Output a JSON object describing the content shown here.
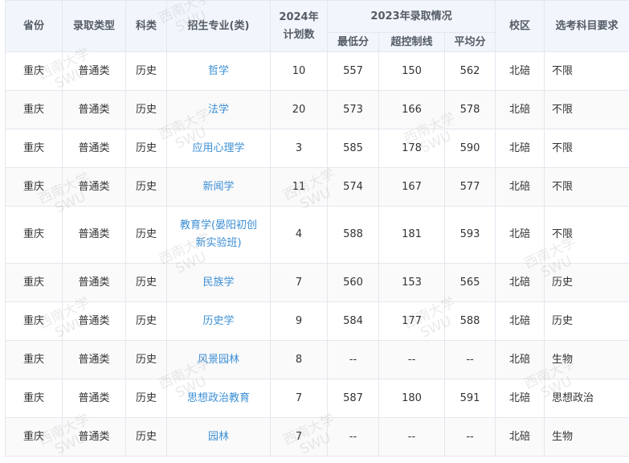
{
  "header": {
    "province": "省份",
    "admission_type": "录取类型",
    "subject_category": "科类",
    "major": "招生专业(类)",
    "plan_year": "2024年",
    "plan_label": "计划数",
    "group_2023": "2023年录取情况",
    "min_score": "最低分",
    "control_line": "超控制线",
    "avg_score": "平均分",
    "campus": "校区",
    "subject_requirement": "选考科目要求"
  },
  "rows": [
    {
      "province": "重庆",
      "type": "普通类",
      "category": "历史",
      "major": "哲学",
      "plan": "10",
      "min": "557",
      "over": "150",
      "avg": "562",
      "campus": "北碚",
      "req": "不限"
    },
    {
      "province": "重庆",
      "type": "普通类",
      "category": "历史",
      "major": "法学",
      "plan": "20",
      "min": "573",
      "over": "166",
      "avg": "578",
      "campus": "北碚",
      "req": "不限"
    },
    {
      "province": "重庆",
      "type": "普通类",
      "category": "历史",
      "major": "应用心理学",
      "plan": "3",
      "min": "585",
      "over": "178",
      "avg": "590",
      "campus": "北碚",
      "req": "不限"
    },
    {
      "province": "重庆",
      "type": "普通类",
      "category": "历史",
      "major": "新闻学",
      "plan": "11",
      "min": "574",
      "over": "167",
      "avg": "577",
      "campus": "北碚",
      "req": "不限"
    },
    {
      "province": "重庆",
      "type": "普通类",
      "category": "历史",
      "major_line1": "教育学(晏阳初创",
      "major_line2": "新实验班)",
      "plan": "4",
      "min": "588",
      "over": "181",
      "avg": "593",
      "campus": "北碚",
      "req": "不限"
    },
    {
      "province": "重庆",
      "type": "普通类",
      "category": "历史",
      "major": "民族学",
      "plan": "7",
      "min": "560",
      "over": "153",
      "avg": "565",
      "campus": "北碚",
      "req": "历史"
    },
    {
      "province": "重庆",
      "type": "普通类",
      "category": "历史",
      "major": "历史学",
      "plan": "9",
      "min": "584",
      "over": "177",
      "avg": "588",
      "campus": "北碚",
      "req": "历史"
    },
    {
      "province": "重庆",
      "type": "普通类",
      "category": "历史",
      "major": "风景园林",
      "plan": "8",
      "min": "--",
      "over": "--",
      "avg": "--",
      "campus": "北碚",
      "req": "生物"
    },
    {
      "province": "重庆",
      "type": "普通类",
      "category": "历史",
      "major": "思想政治教育",
      "plan": "7",
      "min": "587",
      "over": "180",
      "avg": "591",
      "campus": "北碚",
      "req": "思想政治"
    },
    {
      "province": "重庆",
      "type": "普通类",
      "category": "历史",
      "major": "园林",
      "plan": "7",
      "min": "--",
      "over": "--",
      "avg": "--",
      "campus": "北碚",
      "req": "生物"
    }
  ],
  "watermark": {
    "line1": "西南大学",
    "line2": "SWU"
  }
}
